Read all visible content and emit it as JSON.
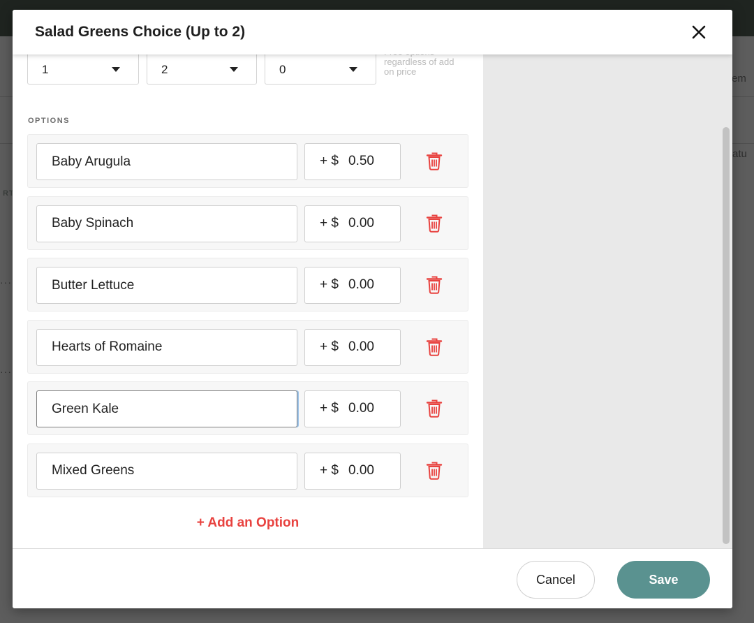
{
  "modal": {
    "title": "Salad Greens Choice (Up to 2)",
    "close_icon": "close-icon"
  },
  "selectors": [
    {
      "value": "1",
      "icon": "chevron-down-icon"
    },
    {
      "value": "2",
      "icon": "chevron-down-icon"
    },
    {
      "value": "0",
      "icon": "chevron-down-icon"
    }
  ],
  "free_options_note": "Free options regardless of add on price",
  "options_heading": "OPTIONS",
  "price_prefix": "+ $",
  "options": [
    {
      "name": "Baby Arugula",
      "price": "0.50",
      "focused": false
    },
    {
      "name": "Baby Spinach",
      "price": "0.00",
      "focused": false
    },
    {
      "name": "Butter Lettuce",
      "price": "0.00",
      "focused": false
    },
    {
      "name": "Hearts of Romaine",
      "price": "0.00",
      "focused": false
    },
    {
      "name": "Green Kale",
      "price": "0.00",
      "focused": true
    },
    {
      "name": "Mixed Greens",
      "price": "0.00",
      "focused": false
    }
  ],
  "add_option_label": "+ Add an Option",
  "footer": {
    "cancel_label": "Cancel",
    "save_label": "Save"
  },
  "background_fragments": {
    "top_right": "em",
    "right_middle": "atu",
    "left_small": "RT"
  },
  "colors": {
    "accent_red": "#e8423f",
    "save_teal": "#5a9290",
    "overlay": "#5d5d5d"
  }
}
